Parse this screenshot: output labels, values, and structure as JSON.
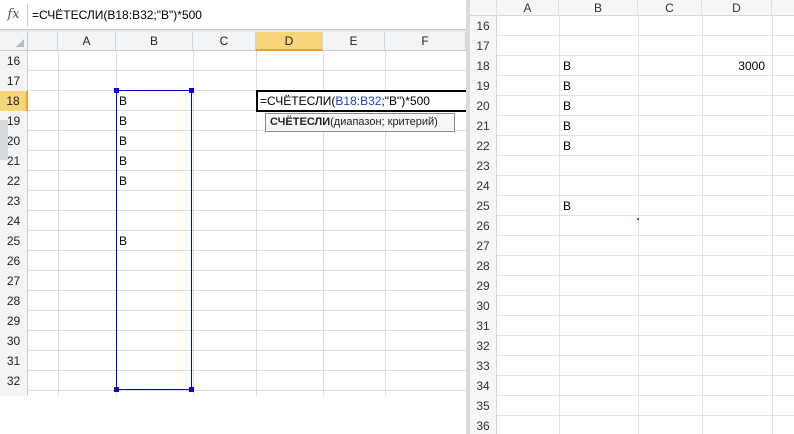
{
  "formula_bar": {
    "icon": "fx",
    "text": "=СЧЁТЕСЛИ(B18:B32;\"В\")*500"
  },
  "left_sheet": {
    "columns": [
      "A",
      "B",
      "C",
      "D",
      "E",
      "F"
    ],
    "active_column": "D",
    "rows": [
      "16",
      "17",
      "18",
      "19",
      "20",
      "21",
      "22",
      "23",
      "24",
      "25",
      "26",
      "27",
      "28",
      "29",
      "30",
      "31",
      "32",
      "33"
    ],
    "active_row": "18",
    "b_values": [
      "",
      "",
      "В",
      "В",
      "В",
      "В",
      "В",
      "",
      "",
      "В",
      "",
      "",
      "",
      "",
      "",
      "",
      "",
      ""
    ],
    "edit": {
      "prefix": "=СЧЁТЕСЛИ(",
      "ref": "B18:B32",
      "suffix": ";\"В\")*500"
    },
    "tooltip": {
      "func": "СЧЁТЕСЛИ",
      "args": "(диапазон; критерий)"
    }
  },
  "right_sheet": {
    "columns": [
      "A",
      "B",
      "C",
      "D"
    ],
    "rows": [
      "16",
      "17",
      "18",
      "19",
      "20",
      "21",
      "22",
      "23",
      "24",
      "25",
      "26",
      "27",
      "28",
      "29",
      "30",
      "31",
      "32",
      "33",
      "34",
      "35",
      "36"
    ],
    "b_values": [
      "",
      "",
      "В",
      "В",
      "В",
      "В",
      "В",
      "",
      "",
      "В",
      "",
      "",
      "",
      "",
      "",
      "",
      "",
      "",
      "",
      "",
      ""
    ],
    "d_values": [
      "",
      "",
      "3000",
      "",
      "",
      "",
      "",
      "",
      "",
      "",
      "",
      "",
      "",
      "",
      "",
      "",
      "",
      "",
      "",
      "",
      ""
    ]
  },
  "colors": {
    "range_border": "#0000ee",
    "reference_text": "#1f3fbf",
    "active_header": "#f7d47a"
  }
}
